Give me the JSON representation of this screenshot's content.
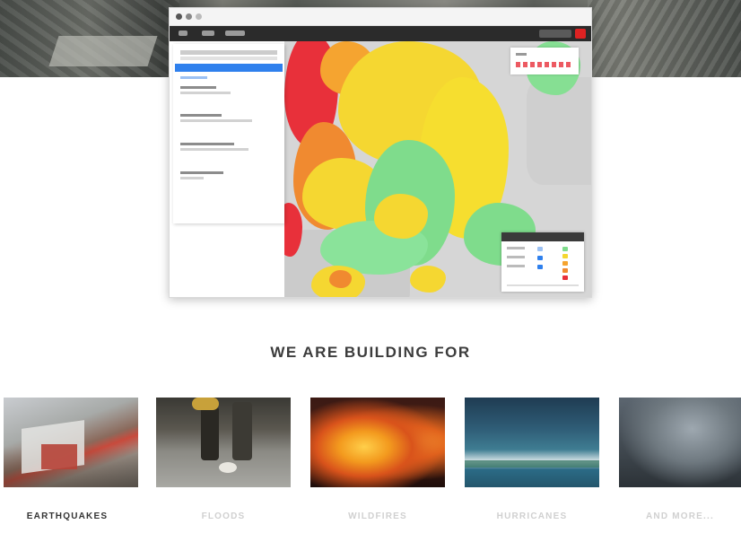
{
  "section": {
    "heading": "WE ARE BUILDING FOR"
  },
  "categories": [
    {
      "label": "EARTHQUAKES",
      "active": true
    },
    {
      "label": "FLOODS",
      "active": false
    },
    {
      "label": "WILDFIRES",
      "active": false
    },
    {
      "label": "HURRICANES",
      "active": false
    },
    {
      "label": "AND MORE...",
      "active": false
    }
  ],
  "colors": {
    "accent_blue": "#2f80ed",
    "risk_red": "#e8303a",
    "risk_orange": "#f08a30",
    "risk_yellow": "#f5d731",
    "risk_green": "#7fdc8c",
    "heading_text": "#3c3c3c"
  },
  "icons": {
    "close": "close-icon",
    "minimize": "minimize-icon",
    "maximize": "maximize-icon"
  }
}
